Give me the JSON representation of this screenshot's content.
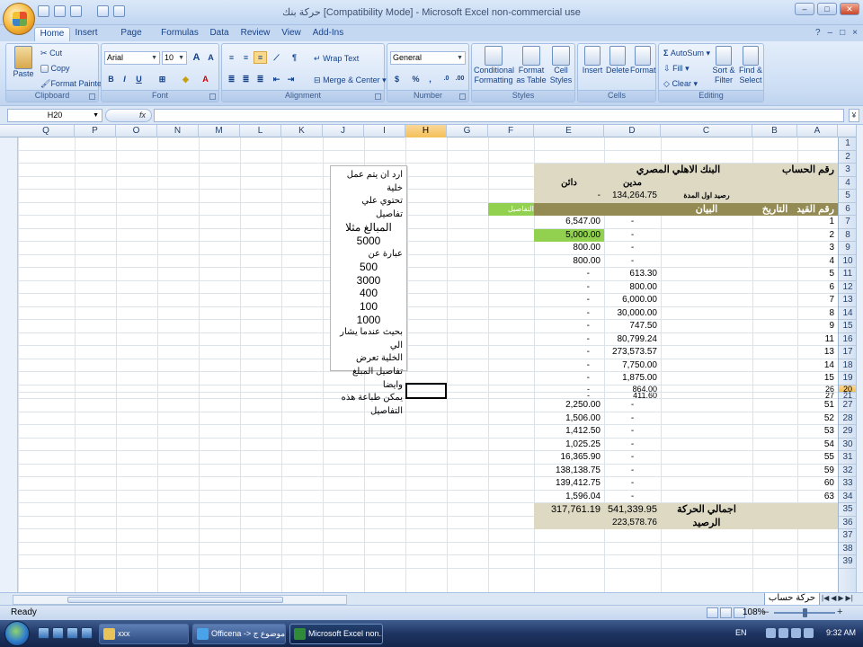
{
  "window": {
    "title": "حركة بنك [Compatibility Mode] - Microsoft Excel non-commercial use",
    "controls": [
      "–",
      "□",
      "✕"
    ]
  },
  "tabs": [
    "Home",
    "Insert",
    "Page Layout",
    "Formulas",
    "Data",
    "Review",
    "View",
    "Add-Ins"
  ],
  "ribbon": {
    "clipboard": {
      "title": "Clipboard",
      "paste": "Paste",
      "cut": "Cut",
      "copy": "Copy",
      "format_painter": "Format Painter"
    },
    "font": {
      "title": "Font",
      "name": "Arial",
      "size": "10",
      "bold": "B",
      "italic": "I",
      "underline": "U",
      "grow": "A",
      "shrink": "A"
    },
    "alignment": {
      "title": "Alignment",
      "wrap": "Wrap Text",
      "merge": "Merge & Center"
    },
    "number": {
      "title": "Number",
      "format": "General",
      "currency": "$",
      "percent": "%",
      "comma": ","
    },
    "styles": {
      "title": "Styles",
      "conditional": "Conditional Formatting",
      "table": "Format as Table",
      "cell": "Cell Styles"
    },
    "cells": {
      "title": "Cells",
      "insert": "Insert",
      "delete": "Delete",
      "format": "Format"
    },
    "editing": {
      "title": "Editing",
      "autosum": "AutoSum",
      "fill": "Fill",
      "clear": "Clear",
      "sort": "Sort & Filter",
      "find": "Find & Select"
    }
  },
  "formula_bar": {
    "name_box": "H20",
    "fx": "fx",
    "content": ""
  },
  "columns": [
    "Q",
    "P",
    "O",
    "N",
    "M",
    "L",
    "K",
    "J",
    "I",
    "H",
    "G",
    "F",
    "E",
    "D",
    "C",
    "B",
    "A"
  ],
  "row_numbers": [
    "1",
    "2",
    "3",
    "4",
    "5",
    "6",
    "7",
    "8",
    "9",
    "10",
    "11",
    "12",
    "13",
    "14",
    "15",
    "16",
    "17",
    "18",
    "19",
    "20",
    "21",
    "27",
    "28",
    "29",
    "30",
    "31",
    "32",
    "33",
    "34",
    "35",
    "36",
    "37",
    "38",
    "39"
  ],
  "header_cells": {
    "account_no": "رقم الحساب",
    "bank": "البنك الاهلي المصري",
    "debit": "مدين",
    "credit": "دائن",
    "opening_label": "رصيد اول المدة",
    "opening_debit": "134,264.75",
    "opening_credit": "-",
    "entry_no": "رقم القيد",
    "date": "التاريخ",
    "statement": "البيان",
    "details": "التفاصيل"
  },
  "entries": [
    {
      "row": "7",
      "entry": "1",
      "debit": "-",
      "credit": "6,547.00"
    },
    {
      "row": "8",
      "entry": "2",
      "debit": "-",
      "credit": "5,000.00"
    },
    {
      "row": "9",
      "entry": "3",
      "debit": "-",
      "credit": "800.00"
    },
    {
      "row": "10",
      "entry": "4",
      "debit": "-",
      "credit": "800.00"
    },
    {
      "row": "11",
      "entry": "5",
      "debit": "613.30",
      "credit": "-"
    },
    {
      "row": "12",
      "entry": "6",
      "debit": "800.00",
      "credit": "-"
    },
    {
      "row": "13",
      "entry": "7",
      "debit": "6,000.00",
      "credit": "-"
    },
    {
      "row": "14",
      "entry": "8",
      "debit": "30,000.00",
      "credit": "-"
    },
    {
      "row": "15",
      "entry": "9",
      "debit": "747.50",
      "credit": "-"
    },
    {
      "row": "16",
      "entry": "11",
      "debit": "80,799.24",
      "credit": "-"
    },
    {
      "row": "17",
      "entry": "13",
      "debit": "273,573.57",
      "credit": "-"
    },
    {
      "row": "18",
      "entry": "14",
      "debit": "7,750.00",
      "credit": "-"
    },
    {
      "row": "19",
      "entry": "15",
      "debit": "1,875.00",
      "credit": "-"
    },
    {
      "row": "20",
      "entry": "26",
      "debit": "864.00",
      "credit": "-"
    },
    {
      "row": "21",
      "entry": "27",
      "debit": "411.60",
      "credit": "-"
    },
    {
      "row": "27",
      "entry": "51",
      "debit": "-",
      "credit": "2,250.00"
    },
    {
      "row": "28",
      "entry": "52",
      "debit": "-",
      "credit": "1,506.00"
    },
    {
      "row": "29",
      "entry": "53",
      "debit": "-",
      "credit": "1,412.50"
    },
    {
      "row": "30",
      "entry": "54",
      "debit": "-",
      "credit": "1,025.25"
    },
    {
      "row": "31",
      "entry": "55",
      "debit": "-",
      "credit": "16,365.90"
    },
    {
      "row": "32",
      "entry": "59",
      "debit": "-",
      "credit": "138,138.75"
    },
    {
      "row": "33",
      "entry": "60",
      "debit": "-",
      "credit": "139,412.75"
    },
    {
      "row": "34",
      "entry": "63",
      "debit": "-",
      "credit": "1,596.04"
    }
  ],
  "totals": {
    "movement_label": "اجمالي الحركة",
    "movement_debit": "541,339.95",
    "movement_credit": "317,761.19",
    "balance_label": "الرصيد",
    "balance_debit": "223,578.76"
  },
  "note": {
    "lines": [
      "ارد ان يتم عمل خلية",
      "تحتوي علي تفاصيل",
      "المبالغ مثلا  5000",
      "عبارة عن",
      "500",
      "3000",
      "400",
      "100",
      "1000",
      "بحيث عندما يشار الي",
      "الخلية تعرض",
      "تفاصيل المبلغ وايضا",
      "يمكن طباعة هذه",
      "التفاصيل"
    ]
  },
  "sheet_tab": "حركة حساب",
  "status": {
    "ready": "Ready",
    "zoom": "108%",
    "zoom_minus": "–",
    "zoom_plus": "+"
  },
  "taskbar": {
    "items": [
      {
        "label": "xxx"
      },
      {
        "label": "Officena -> موضوع ج..."
      },
      {
        "label": "Microsoft Excel non..."
      }
    ],
    "lang": "EN",
    "clock": "9:32 AM"
  },
  "colors": {
    "band_brown": "#ddd9c3",
    "band_dark": "#948a54",
    "band_green": "#92d050",
    "selection": "#f4bf57"
  }
}
